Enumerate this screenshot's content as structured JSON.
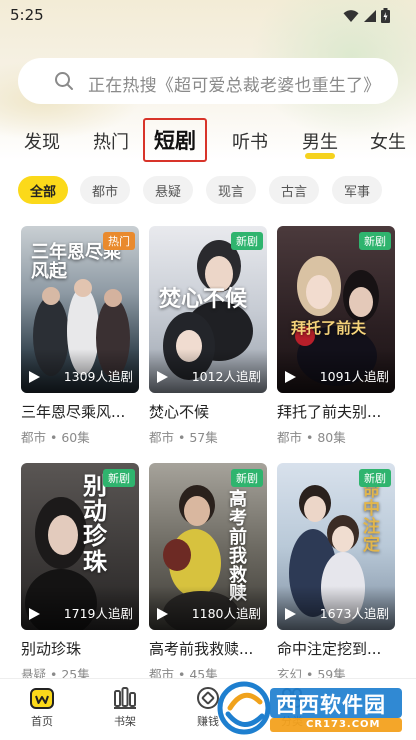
{
  "status_bar": {
    "time": "5:25",
    "icons": [
      "wifi-icon",
      "signal-icon",
      "battery-icon"
    ]
  },
  "search": {
    "placeholder": "正在热搜《超可爱总裁老婆也重生了》"
  },
  "tabs": [
    {
      "label": "发现"
    },
    {
      "label": "热门"
    },
    {
      "label": "短剧",
      "active": true
    },
    {
      "label": "听书"
    },
    {
      "label": "男生"
    },
    {
      "label": "女生"
    }
  ],
  "chips": [
    {
      "label": "全部",
      "active": true
    },
    {
      "label": "都市"
    },
    {
      "label": "悬疑"
    },
    {
      "label": "现言"
    },
    {
      "label": "古言"
    },
    {
      "label": "军事"
    }
  ],
  "cards": [
    {
      "title": "三年恩尽乘风...",
      "meta": "都市 • 60集",
      "views": "1309人追剧",
      "badge": "热门",
      "poster_text": "三年恩尽乘风起"
    },
    {
      "title": "焚心不候",
      "meta": "都市 • 57集",
      "views": "1012人追剧",
      "badge": "新剧",
      "poster_text": "焚心不候"
    },
    {
      "title": "拜托了前夫别...",
      "meta": "都市 • 80集",
      "views": "1091人追剧",
      "badge": "新剧",
      "poster_text": "拜托了前夫"
    },
    {
      "title": "别动珍珠",
      "meta": "悬疑 • 25集",
      "views": "1719人追剧",
      "badge": "新剧",
      "poster_text": "别动珍珠"
    },
    {
      "title": "高考前我救赎...",
      "meta": "都市 • 45集",
      "views": "1180人追剧",
      "badge": "新剧",
      "poster_text": "高考前我救赎"
    },
    {
      "title": "命中注定挖到...",
      "meta": "玄幻 • 59集",
      "views": "1673人追剧",
      "badge": "新剧",
      "poster_text": "命中注定"
    }
  ],
  "bottom_nav": [
    {
      "label": "首页",
      "icon": "home-icon",
      "active": true
    },
    {
      "label": "书架",
      "icon": "bookshelf-icon"
    },
    {
      "label": "赚钱",
      "icon": "coin-icon"
    },
    {
      "label": "分类",
      "icon": "category-icon"
    }
  ],
  "watermark": {
    "text": "西西软件园",
    "subtext": "CR173.COM"
  },
  "colors": {
    "accent": "#fbd91a",
    "highlight_border": "#d8342a",
    "new_badge": "#2fb46e",
    "hot_badge": "#e98a2e"
  }
}
